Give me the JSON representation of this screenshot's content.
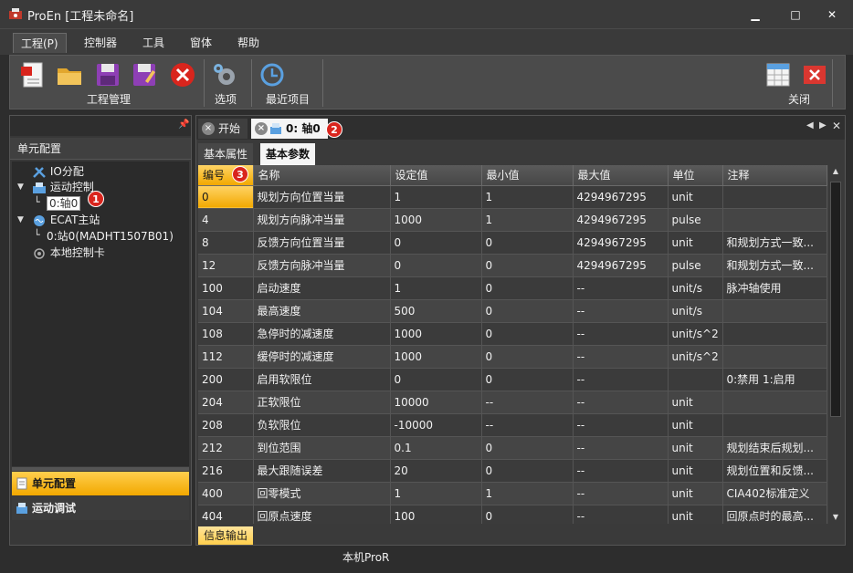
{
  "window": {
    "title": "ProEn [工程未命名]",
    "minimize_label": "▁",
    "maximize_label": "□",
    "close_label": "✕"
  },
  "menu": {
    "items": [
      "工程(P)",
      "控制器",
      "工具",
      "窗体",
      "帮助"
    ]
  },
  "ribbon": {
    "group_project": "工程管理",
    "options": "选项",
    "recent": "最近项目",
    "close": "关闭"
  },
  "left_panel": {
    "title": "单元配置",
    "tree": {
      "io": "IO分配",
      "motion": "运动控制",
      "axis": "0:轴0",
      "ecat": "ECAT主站",
      "station": "0:站0(MADHT1507B01)",
      "local_card": "本地控制卡"
    },
    "nav": [
      "单元配置",
      "运动调试"
    ]
  },
  "doc_tabs": [
    "开始",
    "0: 轴0"
  ],
  "sub_tabs": [
    "基本属性",
    "基本参数"
  ],
  "table": {
    "headers": [
      "编号",
      "名称",
      "设定值",
      "最小值",
      "最大值",
      "单位",
      "注释"
    ],
    "rows": [
      [
        "0",
        "规划方向位置当量",
        "1",
        "1",
        "4294967295",
        "unit",
        ""
      ],
      [
        "4",
        "规划方向脉冲当量",
        "1000",
        "1",
        "4294967295",
        "pulse",
        ""
      ],
      [
        "8",
        "反馈方向位置当量",
        "0",
        "0",
        "4294967295",
        "unit",
        "和规划方式一致..."
      ],
      [
        "12",
        "反馈方向脉冲当量",
        "0",
        "0",
        "4294967295",
        "pulse",
        "和规划方式一致..."
      ],
      [
        "100",
        "启动速度",
        "1",
        "0",
        "--",
        "unit/s",
        "脉冲轴使用"
      ],
      [
        "104",
        "最高速度",
        "500",
        "0",
        "--",
        "unit/s",
        ""
      ],
      [
        "108",
        "急停时的减速度",
        "1000",
        "0",
        "--",
        "unit/s^2",
        ""
      ],
      [
        "112",
        "缓停时的减速度",
        "1000",
        "0",
        "--",
        "unit/s^2",
        ""
      ],
      [
        "200",
        "启用软限位",
        "0",
        "0",
        "--",
        "",
        "0:禁用 1:启用"
      ],
      [
        "204",
        "正软限位",
        "10000",
        "--",
        "--",
        "unit",
        ""
      ],
      [
        "208",
        "负软限位",
        "-10000",
        "--",
        "--",
        "unit",
        ""
      ],
      [
        "212",
        "到位范围",
        "0.1",
        "0",
        "--",
        "unit",
        "规划结束后规划..."
      ],
      [
        "216",
        "最大跟随误差",
        "20",
        "0",
        "--",
        "unit",
        "规划位置和反馈..."
      ],
      [
        "400",
        "回零模式",
        "1",
        "1",
        "--",
        "unit",
        "CIA402标准定义"
      ],
      [
        "404",
        "回原点速度",
        "100",
        "0",
        "--",
        "unit",
        "回原点时的最高..."
      ]
    ]
  },
  "output_tab": "信息输出",
  "status": "本机ProR",
  "badges": [
    "1",
    "2",
    "3"
  ],
  "colors": {
    "accent": "#f2a800",
    "badge": "#d9251d",
    "background": "#2d2d2d"
  }
}
